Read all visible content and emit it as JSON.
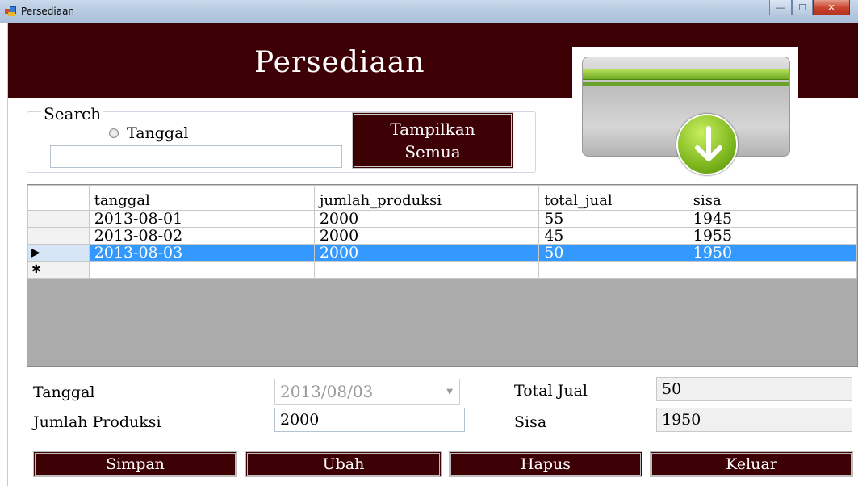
{
  "window": {
    "title": "Persediaan",
    "minimize_glyph": "—",
    "maximize_glyph": "☐",
    "close_glyph": "✕"
  },
  "header": {
    "title": "Persediaan"
  },
  "icons": {
    "app": "window-app-icon",
    "banner": "download-folder-icon"
  },
  "colors": {
    "brand": "#3d0004",
    "selection": "#3399ff"
  },
  "search": {
    "legend": "Search",
    "radio_label": "Tanggal",
    "input_value": "",
    "show_all_label": "Tampilkan\nSemua"
  },
  "grid": {
    "columns": [
      "tanggal",
      "jumlah_produksi",
      "total_jual",
      "sisa"
    ],
    "rows": [
      {
        "marker": "",
        "cells": [
          "2013-08-01",
          "2000",
          "55",
          "1945"
        ]
      },
      {
        "marker": "",
        "cells": [
          "2013-08-02",
          "2000",
          "45",
          "1955"
        ]
      },
      {
        "marker": "▶",
        "cells": [
          "2013-08-03",
          "2000",
          "50",
          "1950"
        ]
      }
    ],
    "new_row_marker": "✱",
    "selected_row": 2
  },
  "form": {
    "tanggal_label": "Tanggal",
    "tanggal_value": "2013/08/03",
    "jumlah_label": "Jumlah Produksi",
    "jumlah_value": "2000",
    "total_jual_label": "Total Jual",
    "total_jual_value": "50",
    "sisa_label": "Sisa",
    "sisa_value": "1950"
  },
  "buttons": {
    "simpan": "Simpan",
    "ubah": "Ubah",
    "hapus": "Hapus",
    "keluar": "Keluar"
  }
}
